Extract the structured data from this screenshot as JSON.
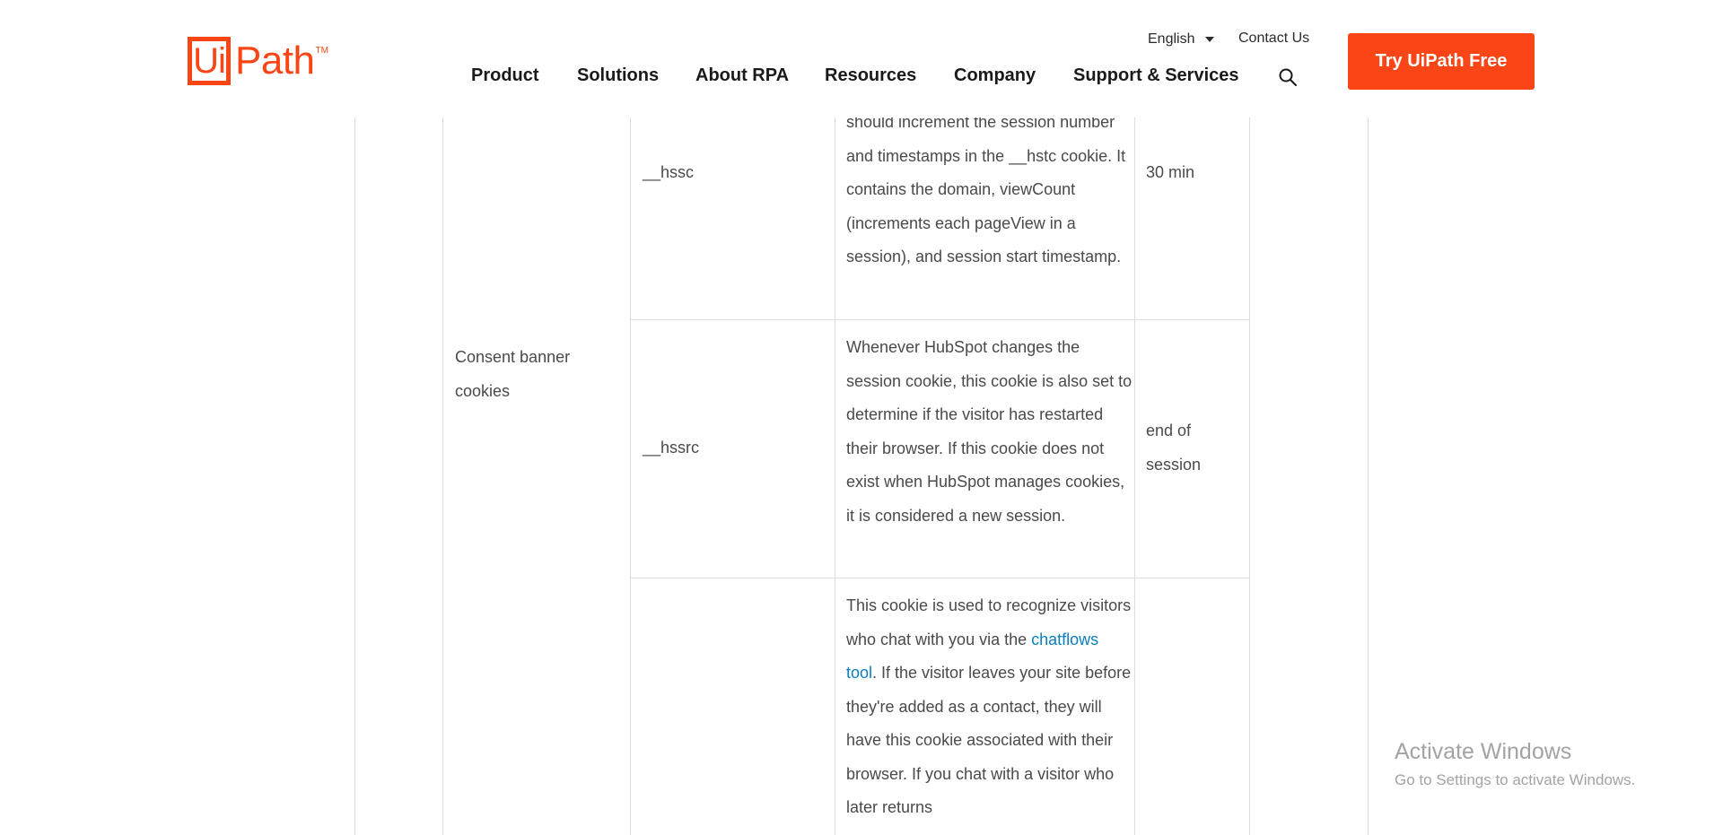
{
  "header": {
    "logo": {
      "mark": "Ui",
      "text": "Path",
      "tm": "TM"
    },
    "language": "English",
    "contact": "Contact Us",
    "nav": [
      "Product",
      "Solutions",
      "About RPA",
      "Resources",
      "Company",
      "Support & Services"
    ],
    "cta": "Try UiPath Free",
    "icons": {
      "search": "search-icon",
      "language_caret": "chevron-down-icon"
    }
  },
  "table": {
    "category": "Consent banner cookies",
    "rows": [
      {
        "name": "__hssc",
        "description": "should increment the session number and timestamps in the __hstc cookie. It contains the domain, viewCount (increments each pageView in a session), and session start timestamp.",
        "expiry": "30 min"
      },
      {
        "name": "__hssrc",
        "description": "Whenever HubSpot changes the session cookie, this cookie is also set to determine if the visitor has restarted their browser. If this cookie does not exist when HubSpot manages cookies, it is considered a new session.",
        "expiry": "end of session"
      },
      {
        "name": "",
        "description_before_link": "This cookie is used to recognize visitors who chat with you via the ",
        "description_link": "chatflows tool",
        "description_after_link": ". If the visitor leaves your site before they're added as a contact, they will have this cookie associated with their browser. If you chat with a visitor who later returns",
        "expiry": ""
      }
    ]
  },
  "watermark": {
    "title": "Activate Windows",
    "subtitle": "Go to Settings to activate Windows."
  },
  "colors": {
    "brand": "#fa4616",
    "link": "#0a7ec2",
    "border": "#dcdcdc"
  }
}
